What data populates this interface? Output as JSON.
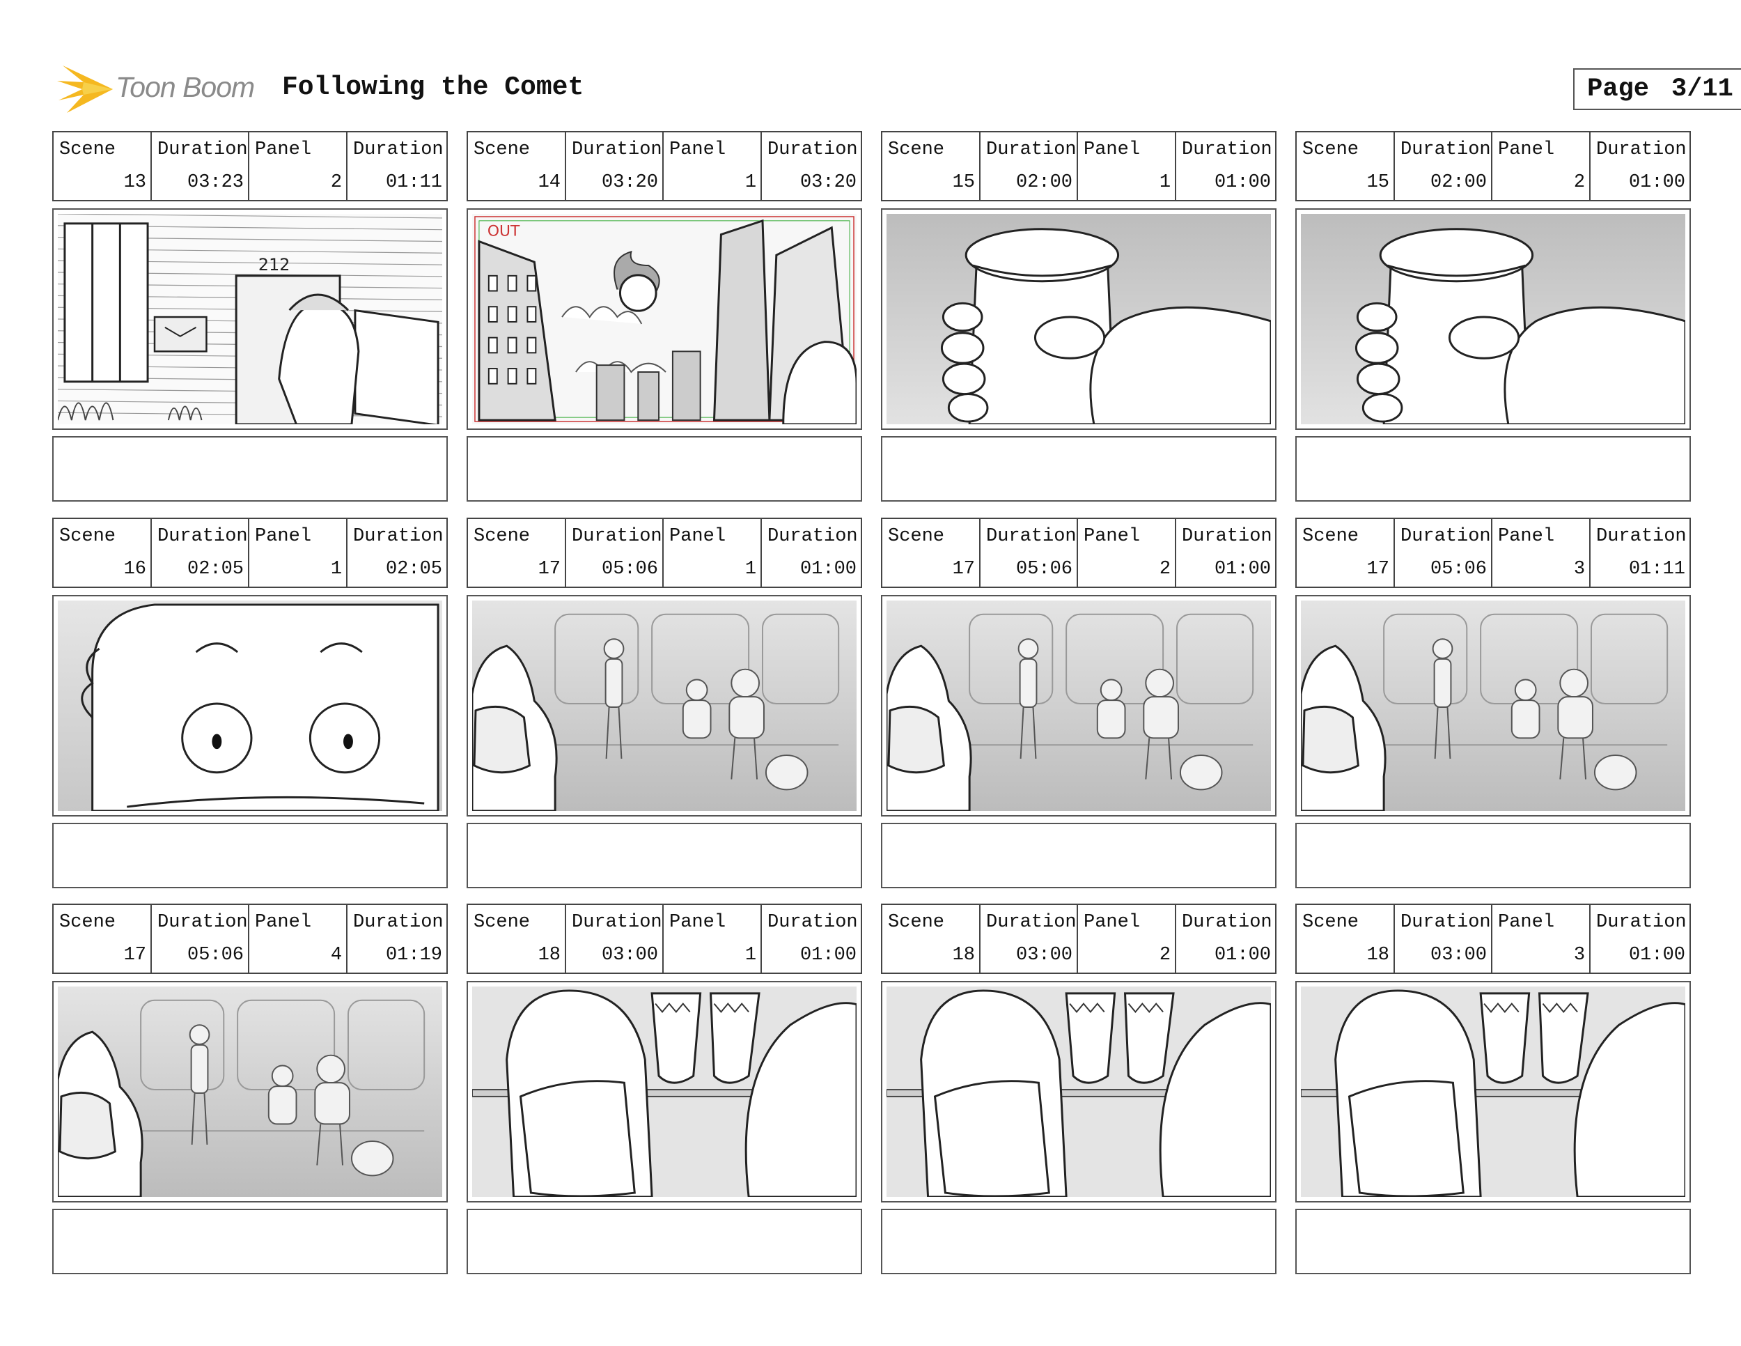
{
  "header": {
    "logo_text": "Toon Boom",
    "title": "Following the Comet",
    "page_label": "Page",
    "page_number": "3/11"
  },
  "labels": {
    "scene": "Scene",
    "duration": "Duration",
    "panel": "Panel"
  },
  "frame_overlay": {
    "out_label": "OUT"
  },
  "panels": [
    {
      "scene": "13",
      "scene_duration": "03:23",
      "panel": "2",
      "panel_duration": "01:11",
      "drawing": "building-door"
    },
    {
      "scene": "14",
      "scene_duration": "03:20",
      "panel": "1",
      "panel_duration": "03:20",
      "drawing": "city-comet"
    },
    {
      "scene": "15",
      "scene_duration": "02:00",
      "panel": "1",
      "panel_duration": "01:00",
      "drawing": "hand-cup"
    },
    {
      "scene": "15",
      "scene_duration": "02:00",
      "panel": "2",
      "panel_duration": "01:00",
      "drawing": "hand-cup"
    },
    {
      "scene": "16",
      "scene_duration": "02:05",
      "panel": "1",
      "panel_duration": "02:05",
      "drawing": "eyes-closeup"
    },
    {
      "scene": "17",
      "scene_duration": "05:06",
      "panel": "1",
      "panel_duration": "01:00",
      "drawing": "train-interior"
    },
    {
      "scene": "17",
      "scene_duration": "05:06",
      "panel": "2",
      "panel_duration": "01:00",
      "drawing": "train-interior"
    },
    {
      "scene": "17",
      "scene_duration": "05:06",
      "panel": "3",
      "panel_duration": "01:11",
      "drawing": "train-interior"
    },
    {
      "scene": "17",
      "scene_duration": "05:06",
      "panel": "4",
      "panel_duration": "01:19",
      "drawing": "train-interior"
    },
    {
      "scene": "18",
      "scene_duration": "03:00",
      "panel": "1",
      "panel_duration": "01:00",
      "drawing": "legs-bench"
    },
    {
      "scene": "18",
      "scene_duration": "03:00",
      "panel": "2",
      "panel_duration": "01:00",
      "drawing": "legs-bench"
    },
    {
      "scene": "18",
      "scene_duration": "03:00",
      "panel": "3",
      "panel_duration": "01:00",
      "drawing": "legs-bench"
    }
  ]
}
